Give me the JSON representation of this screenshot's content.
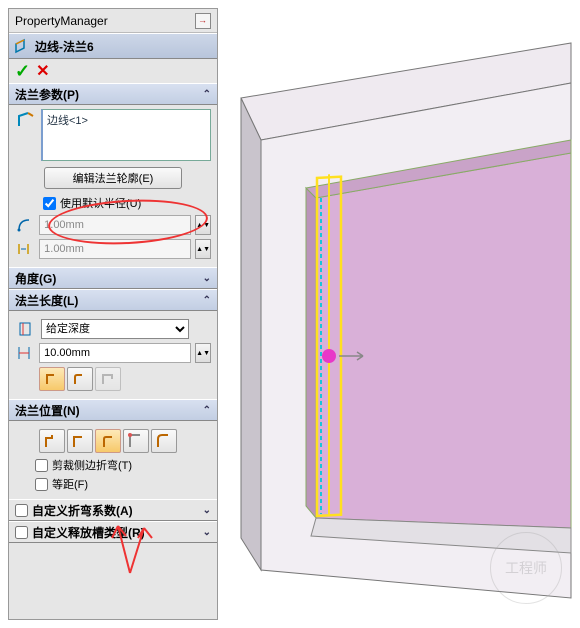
{
  "pm_title": "PropertyManager",
  "feature_name": "边线-法兰6",
  "sections": {
    "params": {
      "title": "法兰参数(P)",
      "edge_item": "边线<1>",
      "edit_profile_btn": "编辑法兰轮廓(E)",
      "use_default_radius": "使用默认半径(U)",
      "radius1": "1.00mm",
      "radius2": "1.00mm"
    },
    "angle": {
      "title": "角度(G)"
    },
    "length": {
      "title": "法兰长度(L)",
      "end_condition": "给定深度",
      "length_value": "10.00mm"
    },
    "position": {
      "title": "法兰位置(N)",
      "trim_side_bends": "剪裁侧边折弯(T)",
      "equal_offset": "等距(F)"
    },
    "custom_bend": {
      "title": "自定义折弯系数(A)"
    },
    "custom_relief": {
      "title": "自定义释放槽类型(R)"
    }
  },
  "colors": {
    "highlight": "#ffee33",
    "face": "#d9b0d8",
    "accent": "#e33",
    "handle": "#e838c8"
  },
  "watermark": "工程师"
}
